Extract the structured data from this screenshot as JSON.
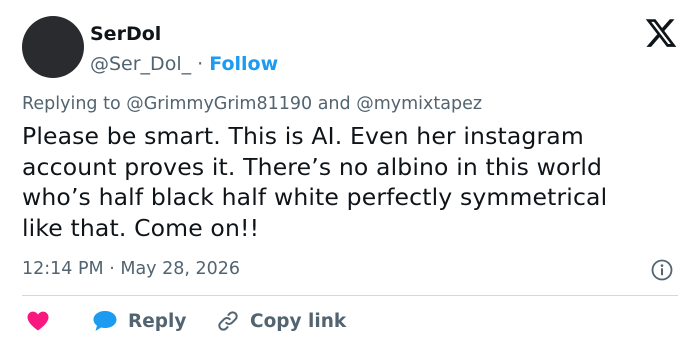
{
  "author": {
    "display_name": "SerDol",
    "handle": "@Ser_Dol_",
    "separator": " · ",
    "follow_label": "Follow"
  },
  "replying": {
    "prefix": "Replying to ",
    "mention_1": "@GrimmyGrim81190",
    "conjunction": " and ",
    "mention_2": "@mymixtapez"
  },
  "tweet": {
    "lines": [
      "Please be smart. This is AI. Even her instagram",
      "account proves it. There’s no albino in this world",
      "who’s half black half white perfectly symmetrical",
      "like that. Come on!!"
    ]
  },
  "meta": {
    "time": "12:14 PM",
    "separator": " · ",
    "date": "May 28, 2026"
  },
  "actions": {
    "reply_label": "Reply",
    "copy_link_label": "Copy link"
  },
  "icons": {
    "logo": "x-logo-icon",
    "info": "info-icon",
    "like": "heart-icon",
    "reply": "speech-bubble-icon",
    "copy": "link-icon"
  },
  "colors": {
    "accent": "#1d9bf0",
    "heart": "#f91880",
    "secondary_text": "#536471",
    "primary_text": "#0f1419",
    "divider": "#cfd9de"
  }
}
